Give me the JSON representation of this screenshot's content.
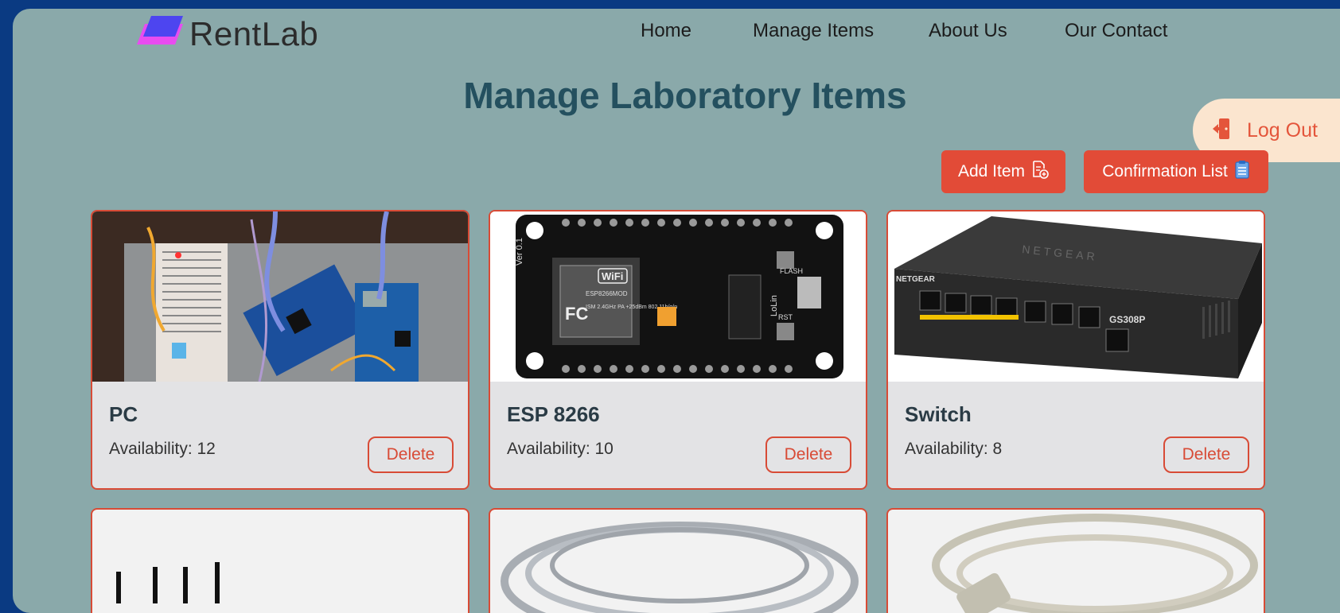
{
  "header": {
    "brand": "RentLab",
    "nav": [
      {
        "label": "Home"
      },
      {
        "label": "Manage Items"
      },
      {
        "label": "About Us"
      },
      {
        "label": "Our Contact"
      }
    ]
  },
  "page": {
    "title": "Manage Laboratory Items",
    "logout_label": "Log Out",
    "add_item_label": "Add Item",
    "confirmation_label": "Confirmation List"
  },
  "items": [
    {
      "name": "PC",
      "availability": "Availability: 12",
      "delete_label": "Delete"
    },
    {
      "name": "ESP 8266",
      "availability": "Availability: 10",
      "delete_label": "Delete"
    },
    {
      "name": "Switch",
      "availability": "Availability: 8",
      "delete_label": "Delete"
    }
  ],
  "esp_photo": {
    "silkscreen_left": "Ver 0.1",
    "chip_logo": "WiFi",
    "chip_model": "ESP8266MOD",
    "chip_spec": "ISM 2.4GHz PA +25dBm 802.11b/g/n",
    "vendor": "FC",
    "board_label": "LoLin",
    "button_flash": "FLASH",
    "button_rst": "RST"
  },
  "switch_photo": {
    "brand_top": "NETGEAR",
    "brand_front": "NETGEAR",
    "model": "GS308P"
  },
  "colors": {
    "page_bg": "#0a3a82",
    "frame_bg": "#8aa9aa",
    "accent": "#e24b37",
    "title": "#24505f",
    "card_bg": "#e3e3e5",
    "logout_bg": "#fbe5cf"
  }
}
